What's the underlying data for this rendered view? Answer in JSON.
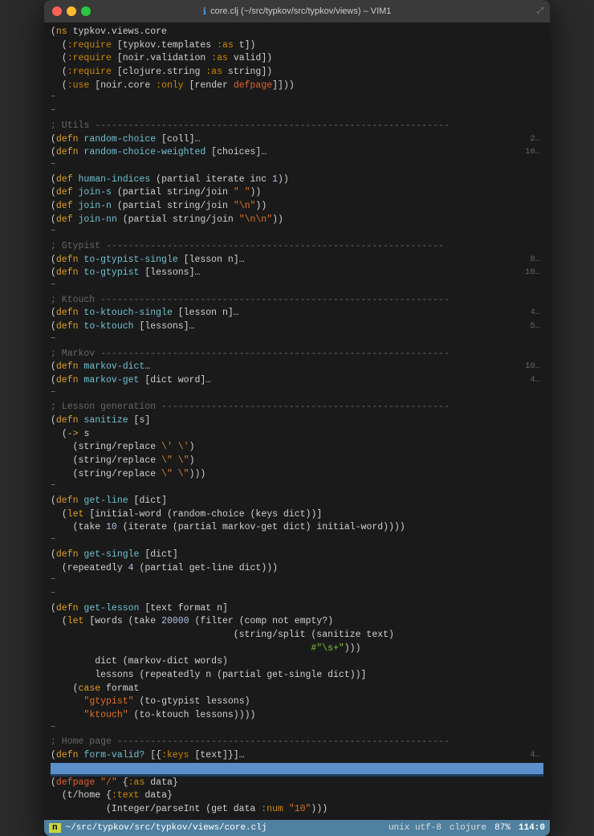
{
  "window": {
    "title": "core.clj (~/src/typkov/src/typkov/views) – VIM1",
    "traffic": [
      "close",
      "minimize",
      "maximize"
    ]
  },
  "status_bar": {
    "mode": "n",
    "file": "~/src/typkov/src/typkov/views/core.clj",
    "encoding": "unix utf-8",
    "filetype": "clojure",
    "percent": "87%",
    "position": "114:0"
  },
  "code": {
    "lines": [
      {
        "text": "(ns typkov.views.core",
        "linenum": ""
      },
      {
        "text": "  (:require [typkov.templates :as t])",
        "linenum": ""
      },
      {
        "text": "  (:require [noir.validation :as valid])",
        "linenum": ""
      },
      {
        "text": "  (:require [clojure.string :as string])",
        "linenum": ""
      },
      {
        "text": "  (:use [noir.core :only [render defpage]]))",
        "linenum": ""
      },
      {
        "text": "~",
        "linenum": ""
      },
      {
        "text": "~",
        "linenum": ""
      },
      {
        "text": "; Utils ----------------------------------------------------------------",
        "linenum": ""
      },
      {
        "text": "(defn random-choice [coll]…",
        "linenum": "2…"
      },
      {
        "text": "(defn random-choice-weighted [choices]…",
        "linenum": "10…"
      },
      {
        "text": "~",
        "linenum": ""
      },
      {
        "text": "(def human-indices (partial iterate inc 1))",
        "linenum": ""
      },
      {
        "text": "(def join-s (partial string/join \" \"))",
        "linenum": ""
      },
      {
        "text": "(def join-n (partial string/join \"\\n\"))",
        "linenum": ""
      },
      {
        "text": "(def join-nn (partial string/join \"\\n\\n\"))",
        "linenum": ""
      },
      {
        "text": "~",
        "linenum": ""
      },
      {
        "text": "; Gtypist -------------------------------------------------------------",
        "linenum": ""
      },
      {
        "text": "(defn to-gtypist-single [lesson n]…",
        "linenum": "8…"
      },
      {
        "text": "(defn to-gtypist [lessons]…",
        "linenum": "10…"
      },
      {
        "text": "~",
        "linenum": ""
      },
      {
        "text": "; Ktouch ---------------------------------------------------------------",
        "linenum": ""
      },
      {
        "text": "(defn to-ktouch-single [lesson n]…",
        "linenum": "4…"
      },
      {
        "text": "(defn to-ktouch [lessons]…",
        "linenum": "5…"
      },
      {
        "text": "~",
        "linenum": ""
      },
      {
        "text": "; Markov ---------------------------------------------------------------",
        "linenum": ""
      },
      {
        "text": "(defn markov-dict…",
        "linenum": "10…"
      },
      {
        "text": "(defn markov-get [dict word]…",
        "linenum": "4…"
      },
      {
        "text": "~",
        "linenum": ""
      },
      {
        "text": "; Lesson generation ----------------------------------------------------",
        "linenum": ""
      },
      {
        "text": "(defn sanitize [s]",
        "linenum": ""
      },
      {
        "text": "  (-> s",
        "linenum": ""
      },
      {
        "text": "    (string/replace \\' \\')",
        "linenum": ""
      },
      {
        "text": "    (string/replace \\\" \\\")",
        "linenum": ""
      },
      {
        "text": "    (string/replace \\\" \\\")))",
        "linenum": ""
      },
      {
        "text": "~",
        "linenum": ""
      },
      {
        "text": "(defn get-line [dict]",
        "linenum": ""
      },
      {
        "text": "  (let [initial-word (random-choice (keys dict))]",
        "linenum": ""
      },
      {
        "text": "    (take 10 (iterate (partial markov-get dict) initial-word))))",
        "linenum": ""
      },
      {
        "text": "~",
        "linenum": ""
      },
      {
        "text": "(defn get-single [dict]",
        "linenum": ""
      },
      {
        "text": "  (repeatedly 4 (partial get-line dict)))",
        "linenum": ""
      },
      {
        "text": "~",
        "linenum": ""
      },
      {
        "text": "~",
        "linenum": ""
      },
      {
        "text": "(defn get-lesson [text format n]",
        "linenum": ""
      },
      {
        "text": "  (let [words (take 20000 (filter (comp not empty?)",
        "linenum": ""
      },
      {
        "text": "                                 (string/split (sanitize text)",
        "linenum": ""
      },
      {
        "text": "                                               #\"\\s+\")))",
        "linenum": ""
      },
      {
        "text": "        dict (markov-dict words)",
        "linenum": ""
      },
      {
        "text": "        lessons (repeatedly n (partial get-single dict))]",
        "linenum": ""
      },
      {
        "text": "    (case format",
        "linenum": ""
      },
      {
        "text": "      \"gtypist\" (to-gtypist lessons)",
        "linenum": ""
      },
      {
        "text": "      \"ktouch\" (to-ktouch lessons))))",
        "linenum": ""
      },
      {
        "text": "~",
        "linenum": ""
      },
      {
        "text": "; Home page ------------------------------------------------------------",
        "linenum": ""
      },
      {
        "text": "(defn form-valid? [{:keys [text]}]…",
        "linenum": "4…"
      },
      {
        "text": "",
        "linenum": ""
      },
      {
        "text": "(defpage \"/\" {:as data}",
        "linenum": ""
      },
      {
        "text": "  (t/home {:text data}",
        "linenum": ""
      },
      {
        "text": "          (Integer/parseInt (get data :num \"10\")))",
        "linenum": ""
      }
    ]
  }
}
